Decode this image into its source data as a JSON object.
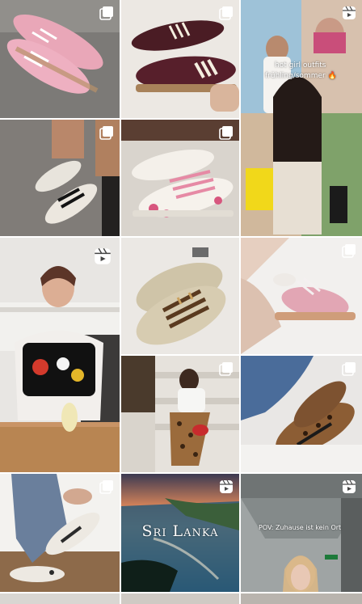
{
  "feed": {
    "tiles": [
      {
        "type": "carousel",
        "caption": ""
      },
      {
        "type": "carousel",
        "caption": ""
      },
      {
        "type": "reel",
        "caption_lines": [
          "hot girl outfits",
          "frühling/sommer 🔥"
        ]
      },
      {
        "type": "carousel",
        "caption": ""
      },
      {
        "type": "carousel",
        "caption": ""
      },
      {
        "type": "reel",
        "caption": ""
      },
      {
        "type": "photo",
        "caption": ""
      },
      {
        "type": "photo",
        "caption": ""
      },
      {
        "type": "carousel",
        "caption": ""
      },
      {
        "type": "carousel",
        "caption": ""
      },
      {
        "type": "carousel",
        "caption": ""
      },
      {
        "type": "carousel",
        "caption": ""
      },
      {
        "type": "reel",
        "caption": "Sri Lanka"
      },
      {
        "type": "reel",
        "caption": "POV: Zuhause ist kein Ort"
      }
    ]
  },
  "icons": {
    "carousel": "carousel-icon",
    "reel": "reel-icon"
  }
}
